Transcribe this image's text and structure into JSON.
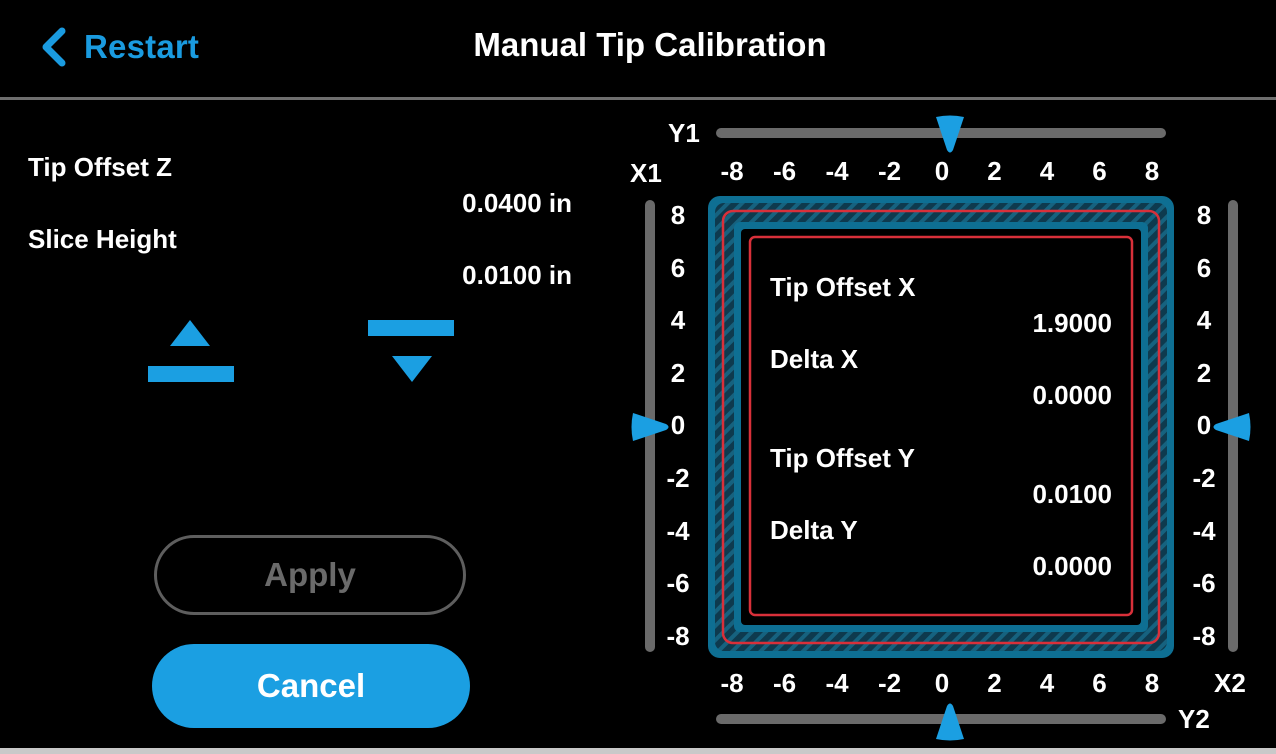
{
  "header": {
    "back_label": "Restart",
    "title": "Manual Tip Calibration"
  },
  "z_panel": {
    "tip_offset_z_label": "Tip Offset Z",
    "tip_offset_z_value": "0.0400 in",
    "slice_height_label": "Slice Height",
    "slice_height_value": "0.0100 in",
    "raise_icon": "raise-bed-icon",
    "lower_icon": "lower-bed-icon"
  },
  "buttons": {
    "apply_label": "Apply",
    "apply_enabled": false,
    "cancel_label": "Cancel"
  },
  "calibration": {
    "y1_label": "Y1",
    "y2_label": "Y2",
    "x1_label": "X1",
    "x2_label": "X2",
    "horizontal_ticks": [
      "-8",
      "-6",
      "-4",
      "-2",
      "0",
      "2",
      "4",
      "6",
      "8"
    ],
    "vertical_ticks": [
      "8",
      "6",
      "4",
      "2",
      "0",
      "-2",
      "-4",
      "-6",
      "-8"
    ],
    "slider_values": {
      "y1": 0,
      "y2": 0,
      "x1": 0,
      "x2": 0
    },
    "slider_range": [
      -8,
      8
    ],
    "tip_offset_x_label": "Tip Offset X",
    "tip_offset_x_value": "1.9000",
    "delta_x_label": "Delta X",
    "delta_x_value": "0.0000",
    "tip_offset_y_label": "Tip Offset Y",
    "tip_offset_y_value": "0.0100",
    "delta_y_label": "Delta Y",
    "delta_y_value": "0.0000"
  },
  "colors": {
    "accent": "#1b9fe2",
    "outer_frame": "#0e6f93",
    "inner_outline": "#d9303a",
    "track": "#6a6a6a",
    "disabled_text": "#6a6a6a"
  }
}
